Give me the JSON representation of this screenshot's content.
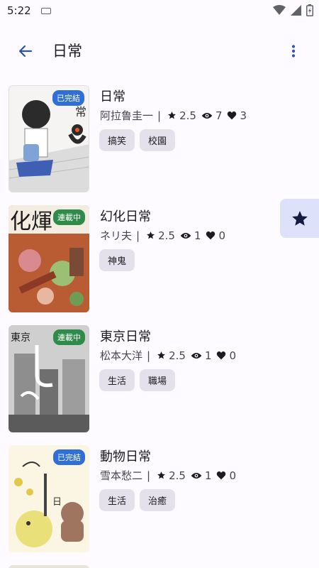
{
  "status_bar": {
    "time": "5:22",
    "icons": [
      "keyboard-icon",
      "wifi-icon",
      "signal-icon",
      "battery-icon"
    ]
  },
  "app_bar": {
    "title": "日常",
    "back_icon": "arrow-back-icon",
    "menu_icon": "more-vert-icon"
  },
  "colors": {
    "accent": "#2f55a8",
    "badge_completed": "#2f6fd6",
    "badge_ongoing": "#2e8b4a",
    "tag_bg": "#e5e1ec",
    "fab_bg": "#dde1f9"
  },
  "items": [
    {
      "title": "日常",
      "author": "阿拉鲁圭一",
      "rating": "2.5",
      "views": "7",
      "likes": "3",
      "badge": "已完結",
      "badge_type": "completed",
      "tags": [
        "搞笑",
        "校園"
      ]
    },
    {
      "title": "幻化日常",
      "author": "ネリ夫",
      "rating": "2.5",
      "views": "1",
      "likes": "0",
      "badge": "連載中",
      "badge_type": "ongoing",
      "tags": [
        "神鬼"
      ]
    },
    {
      "title": "東京日常",
      "author": "松本大洋",
      "rating": "2.5",
      "views": "1",
      "likes": "0",
      "badge": "連載中",
      "badge_type": "ongoing",
      "tags": [
        "生活",
        "職場"
      ]
    },
    {
      "title": "動物日常",
      "author": "雪本愁二",
      "rating": "2.5",
      "views": "1",
      "likes": "0",
      "badge": "已完結",
      "badge_type": "completed",
      "tags": [
        "生活",
        "治癒"
      ]
    }
  ],
  "fab": {
    "icon": "star-icon"
  }
}
